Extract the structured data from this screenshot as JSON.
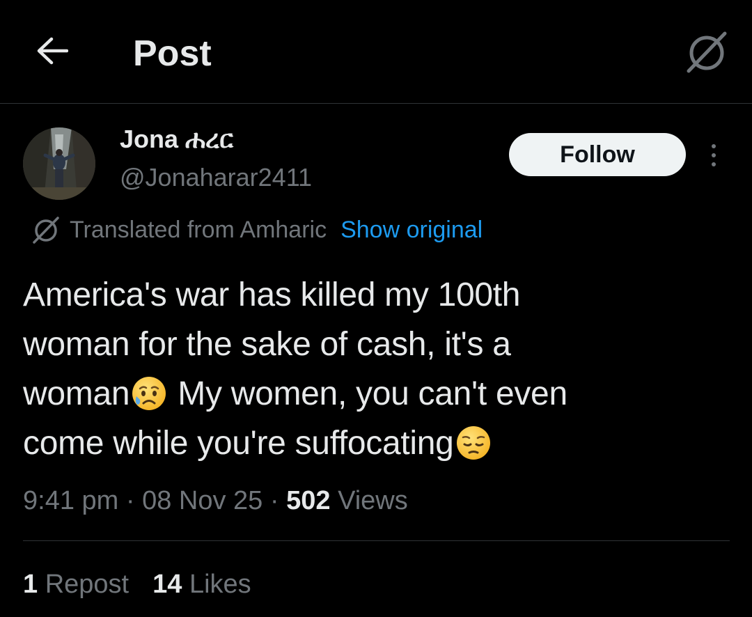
{
  "header": {
    "title": "Post",
    "back_icon": "arrow-left-icon",
    "translate_icon": "translate-icon"
  },
  "author": {
    "display_name": "Jona ሐረር",
    "handle": "@Jonaharar2411",
    "avatar_icon": "avatar"
  },
  "actions": {
    "follow_label": "Follow",
    "more_icon": "more-vertical-icon"
  },
  "translation": {
    "label": "Translated from Amharic",
    "show_original": "Show original"
  },
  "post": {
    "line1": "America's war has killed my 100th",
    "line2": "woman for the sake of cash, it's a",
    "line3_a": "woman",
    "line3_b": " My women, you can't even",
    "line4": "come while you're suffocating",
    "emoji1": "sad-relieved-face-icon",
    "emoji2": "pensive-face-icon"
  },
  "meta": {
    "time": "9:41 pm",
    "sep1": " · ",
    "date": "08 Nov 25",
    "sep2": " · ",
    "views_count": "502",
    "views_label": " Views"
  },
  "stats": {
    "reposts_count": "1",
    "reposts_label": " Repost",
    "likes_count": "14",
    "likes_label": " Likes"
  },
  "colors": {
    "background": "#000000",
    "text_primary": "#e7e9ea",
    "text_secondary": "#71767b",
    "accent": "#1d9bf0",
    "divider": "#2f3336",
    "follow_bg": "#eff3f4"
  }
}
